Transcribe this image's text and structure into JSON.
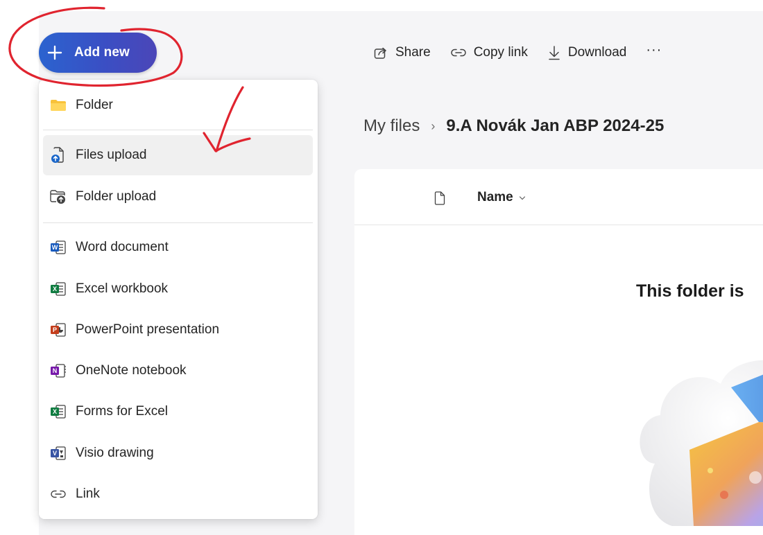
{
  "add_new": {
    "label": "Add new",
    "icon": "plus-icon",
    "brand_gradient": [
      "#2b63cf",
      "#4b46b8"
    ]
  },
  "toolbar": {
    "share_label": "Share",
    "copy_link_label": "Copy link",
    "download_label": "Download",
    "more_label": "···"
  },
  "breadcrumb": {
    "root": "My files",
    "separator": "›",
    "current": "9.A Novák Jan ABP 2024-25"
  },
  "files": {
    "name_column": "Name",
    "empty_title": "This folder is"
  },
  "menu": {
    "items": [
      {
        "label": "Folder",
        "icon": "folder-icon"
      },
      {
        "label": "Files upload",
        "icon": "file-upload-icon",
        "highlighted": true
      },
      {
        "label": "Folder upload",
        "icon": "folder-upload-icon"
      },
      {
        "label": "Word document",
        "icon": "word-icon",
        "color": "#185abd"
      },
      {
        "label": "Excel workbook",
        "icon": "excel-icon",
        "color": "#107c41"
      },
      {
        "label": "PowerPoint presentation",
        "icon": "powerpoint-icon",
        "color": "#c43e1c"
      },
      {
        "label": "OneNote notebook",
        "icon": "onenote-icon",
        "color": "#7719aa"
      },
      {
        "label": "Forms for Excel",
        "icon": "forms-excel-icon",
        "color": "#107c41"
      },
      {
        "label": "Visio drawing",
        "icon": "visio-icon",
        "color": "#3955a3"
      },
      {
        "label": "Link",
        "icon": "link-icon"
      }
    ]
  },
  "annotation_color": "#e0242f"
}
